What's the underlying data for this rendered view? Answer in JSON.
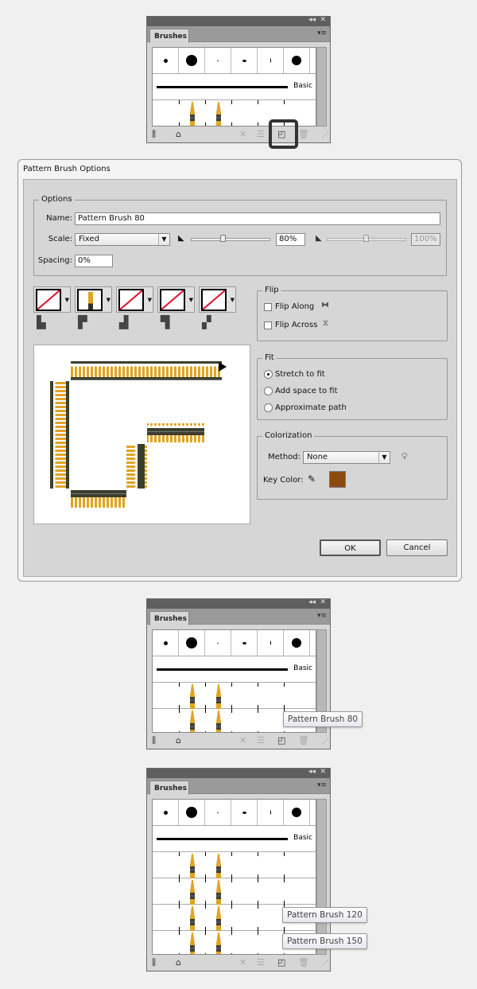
{
  "brushes_panels": [
    {
      "tab": "Brushes",
      "basic_label": "Basic",
      "pattern_rows": 2,
      "tooltips": [],
      "highlight_new_brush": true
    },
    {
      "tab": "Brushes",
      "basic_label": "Basic",
      "pattern_rows": 2,
      "tooltips": [
        "Pattern Brush 80"
      ],
      "highlight_new_brush": false
    },
    {
      "tab": "Brushes",
      "basic_label": "Basic",
      "pattern_rows": 4,
      "tooltips": [
        "Pattern Brush 120",
        "Pattern Brush 150"
      ],
      "highlight_new_brush": false
    }
  ],
  "panel_icons": [
    "brush-libraries-icon",
    "libraries-cloud-icon",
    "remove-stroke-icon",
    "brush-options-icon",
    "new-brush-icon",
    "delete-brush-icon"
  ],
  "dialog": {
    "title": "Pattern Brush Options",
    "options": {
      "legend": "Options",
      "name_label": "Name:",
      "name_value": "Pattern Brush 80",
      "scale_label": "Scale:",
      "scale_value": "Fixed",
      "scale_percent": "80%",
      "scale_percent_2": "100%",
      "scale_slider_value": 80,
      "spacing_label": "Spacing:",
      "spacing_value": "0%"
    },
    "tiles": [
      "side-tile",
      "outer-corner-tile",
      "inner-corner-tile",
      "start-tile",
      "end-tile"
    ],
    "flip": {
      "legend": "Flip",
      "along": "Flip Along",
      "across": "Flip Across"
    },
    "fit": {
      "legend": "Fit",
      "options": [
        "Stretch to fit",
        "Add space to fit",
        "Approximate path"
      ],
      "selected": 0
    },
    "colorization": {
      "legend": "Colorization",
      "method_label": "Method:",
      "method_value": "None",
      "key_color_label": "Key Color:",
      "key_color": "#8b4a10"
    },
    "ok": "OK",
    "cancel": "Cancel"
  }
}
